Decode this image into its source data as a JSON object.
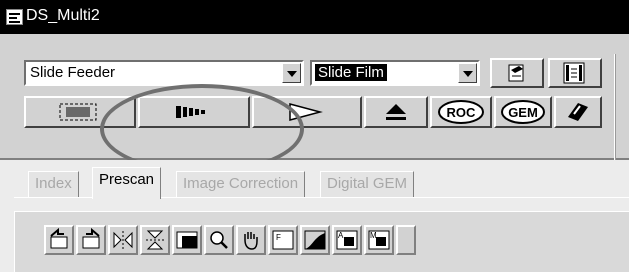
{
  "window": {
    "title": "DS_Multi2"
  },
  "controls": {
    "source_select": {
      "value": "Slide Feeder"
    },
    "film_select": {
      "value": "Slide Film"
    }
  },
  "buttons": {
    "roc_label": "ROC",
    "gem_label": "GEM"
  },
  "tabs": [
    {
      "label": "Index",
      "active": false
    },
    {
      "label": "Prescan",
      "active": true
    },
    {
      "label": "Image Correction",
      "active": false
    },
    {
      "label": "Digital GEM",
      "active": false
    }
  ],
  "tools": [
    "rotate-left-icon",
    "rotate-right-icon",
    "flip-horizontal-icon",
    "flip-vertical-icon",
    "crop-icon",
    "zoom-icon",
    "hand-icon",
    "white-point-icon",
    "tone-curve-icon",
    "auto-exposure-icon",
    "manual-exposure-icon"
  ],
  "tool_letters": {
    "white_point": "F",
    "auto": "A",
    "manual": "M"
  },
  "colors": {
    "titlebar": "#000000",
    "panel": "#d2d2d2",
    "highlight_oval": "#707070"
  }
}
